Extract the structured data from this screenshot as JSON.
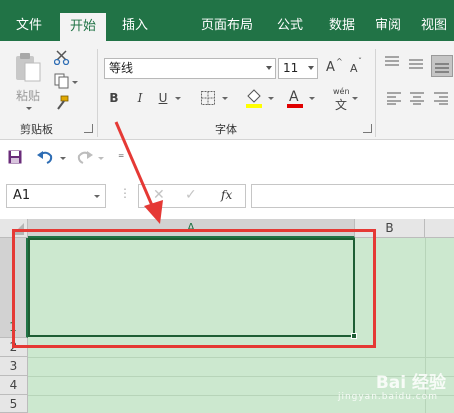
{
  "tabs": [
    "文件",
    "开始",
    "插入",
    "页面布局",
    "公式",
    "数据",
    "审阅",
    "视图"
  ],
  "active_tab": "开始",
  "ribbon": {
    "clipboard": {
      "paste_label": "粘贴",
      "group_label": "剪贴板"
    },
    "font": {
      "font_name": "等线",
      "font_size": "11",
      "bold": "B",
      "italic": "I",
      "underline": "U",
      "phonetic_top": "wén",
      "phonetic_bottom": "文",
      "group_label": "字体",
      "grow_font": "A",
      "shrink_font": "A"
    }
  },
  "formula_bar": {
    "name_box": "A1",
    "fx_label": "fx",
    "formula_value": ""
  },
  "sheet": {
    "columns": [
      "A",
      "B"
    ],
    "rows": [
      "1",
      "2",
      "3",
      "4",
      "5"
    ],
    "selected_cell": "A1"
  },
  "watermark": {
    "brand": "Bai 经验",
    "url": "jingyan.baidu.com"
  },
  "colors": {
    "excel_green": "#217346",
    "cell_fill": "#cce8cf",
    "annotation_red": "#e53935"
  }
}
